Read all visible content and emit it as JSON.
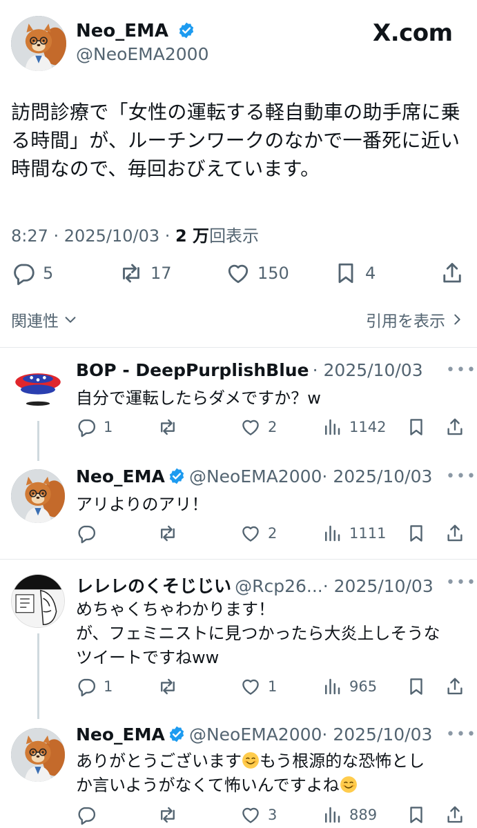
{
  "brand": {
    "text": "X.com"
  },
  "main_post": {
    "display_name": "Neo_EMA",
    "handle": "@NeoEMA2000",
    "body_line1": "訪問診療で「女性の運転する軽自動車の助手席に乗",
    "body_line2": "る時間」が、ルーチンワークのなかで一番死に近い",
    "body_line3": "時間なので、毎回おびえています。",
    "time": "8:27 · 2025/10/03 · ",
    "views_number": "2 万",
    "views_label": "回表示",
    "replies": "5",
    "reposts": "17",
    "likes": "150",
    "bookmarks": "4",
    "related_label": "関連性",
    "quotes_label": "引用を表示"
  },
  "replies": [
    {
      "display_name": "BOP - DeepPurplishBlue",
      "handle": "",
      "date": "· 2025/10/03",
      "text_lines": [
        "自分で運転したらダメですか？w"
      ],
      "replies": "1",
      "reposts": "",
      "likes": "2",
      "views": "1142"
    },
    {
      "display_name": "Neo_EMA",
      "handle": "@NeoEMA2000",
      "date": "· 2025/10/03",
      "text_lines": [
        "アリよりのアリ！"
      ],
      "replies": "",
      "reposts": "",
      "likes": "2",
      "views": "1111"
    },
    {
      "display_name": "レレレのくそじじい",
      "handle": "@Rcp26...",
      "date": "· 2025/10/03",
      "text_lines": [
        "めちゃくちゃわかります！",
        "が、フェミニストに見つかったら大炎上しそうな",
        "ツイートですねww"
      ],
      "replies": "1",
      "reposts": "",
      "likes": "1",
      "views": "965"
    },
    {
      "display_name": "Neo_EMA",
      "handle": "@NeoEMA2000",
      "date": "· 2025/10/03",
      "text_line1a": "ありがとうございます",
      "text_line1b": "もう根源的な恐怖とし",
      "text_line2": "か言いようがなくて怖いんですよね",
      "replies": "",
      "reposts": "",
      "likes": "3",
      "views": "889"
    }
  ],
  "colors": {
    "text": "#0f1419",
    "secondary": "#536471",
    "verified": "#1d9bf0",
    "divider": "#e6e9eb"
  },
  "icons": [
    "verified-badge-icon",
    "reply-icon",
    "repost-icon",
    "like-icon",
    "views-icon",
    "bookmark-icon",
    "share-icon",
    "chevron-down-icon",
    "chevron-right-icon",
    "more-icon"
  ]
}
